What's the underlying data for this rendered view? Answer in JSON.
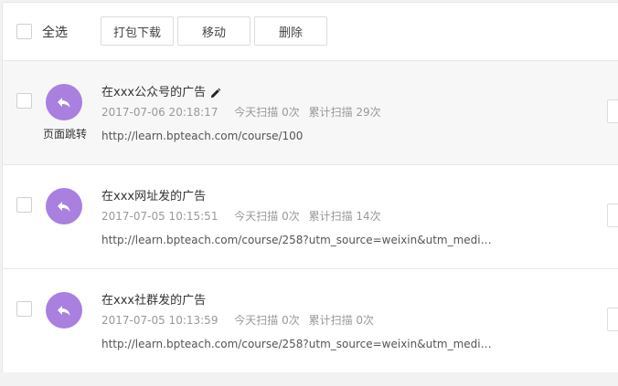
{
  "toolbar": {
    "select_all_label": "全选",
    "buttons": [
      "打包下载",
      "移动",
      "删除"
    ]
  },
  "items": [
    {
      "title": "在xxx公众号的广告",
      "has_edit_icon": true,
      "type_label": "页面跳转",
      "date": "2017-07-06 20:18:17",
      "today_scans": "今天扫描 0次",
      "total_scans": "累计扫描 29次",
      "url": "http://learn.bpteach.com/course/100",
      "highlighted": true
    },
    {
      "title": "在xxx网址发的广告",
      "has_edit_icon": false,
      "type_label": "",
      "date": "2017-07-05 10:15:51",
      "today_scans": "今天扫描 0次",
      "total_scans": "累计扫描 14次",
      "url": "http://learn.bpteach.com/course/258?utm_source=weixin&utm_medium=soci...",
      "highlighted": false
    },
    {
      "title": "在xxx社群发的广告",
      "has_edit_icon": false,
      "type_label": "",
      "date": "2017-07-05 10:13:59",
      "today_scans": "今天扫描 0次",
      "total_scans": "累计扫描 0次",
      "url": "http://learn.bpteach.com/course/258?utm_source=weixin&utm_medium=soci...",
      "highlighted": false
    }
  ],
  "colors": {
    "avatar": "#a97fe0",
    "row_highlight": "#f7f7f7"
  },
  "icons": {
    "avatar": "reply-arrow-icon",
    "edit": "pencil-icon"
  }
}
